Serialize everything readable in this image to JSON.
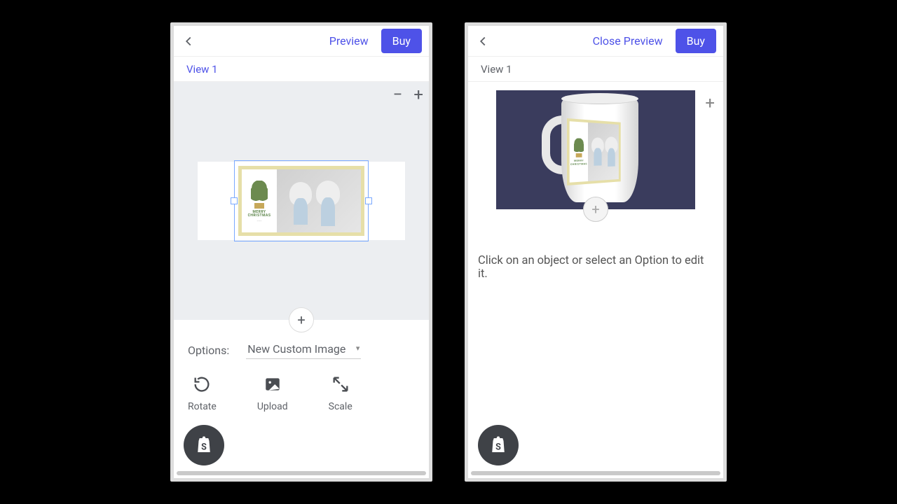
{
  "left": {
    "topbar": {
      "preview": "Preview",
      "buy": "Buy"
    },
    "view_label": "View 1",
    "zoom": {
      "minus": "−",
      "plus": "+"
    },
    "fab_plus": "+",
    "options_label": "Options:",
    "options_selected": "New Custom Image",
    "tools": {
      "rotate": "Rotate",
      "upload": "Upload",
      "scale": "Scale"
    },
    "design_greeting_line1": "MERRY",
    "design_greeting_line2": "CHRISTMAS"
  },
  "right": {
    "topbar": {
      "close_preview": "Close Preview",
      "buy": "Buy"
    },
    "view_label": "View 1",
    "zoom": {
      "minus": "−",
      "plus": "+"
    },
    "fab_plus": "+",
    "hint": "Click on an object or select an Option to edit it."
  }
}
